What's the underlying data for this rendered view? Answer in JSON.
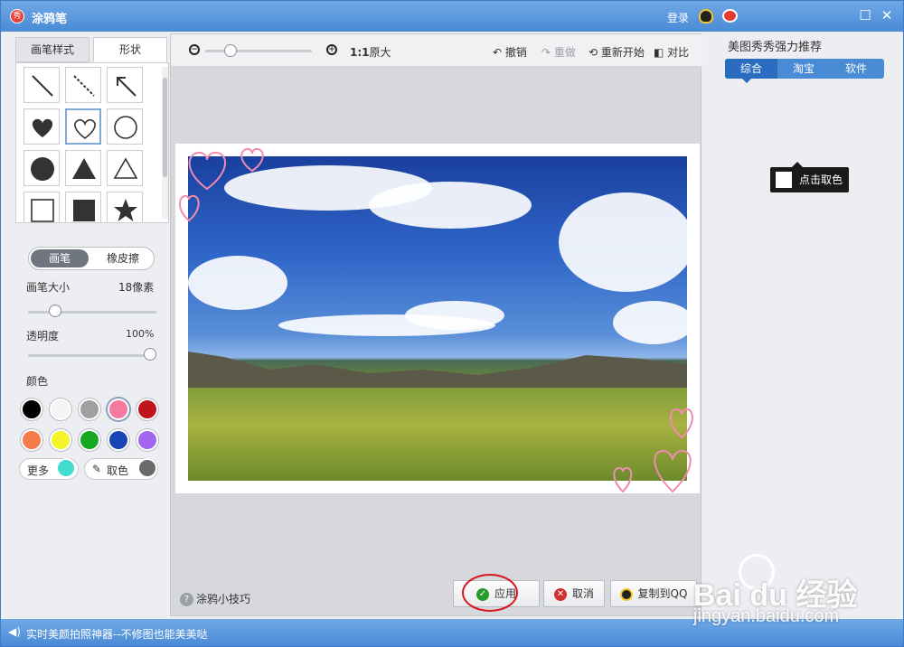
{
  "window": {
    "title": "涂鸦笔",
    "login": "登录",
    "min": "☐",
    "close": "✕"
  },
  "left": {
    "tabs": [
      {
        "label": "画笔样式"
      },
      {
        "label": "形状"
      }
    ],
    "mode": {
      "brush": "画笔",
      "eraser": "橡皮擦"
    },
    "size": {
      "label": "画笔大小",
      "value": "18像素",
      "level": 0.18
    },
    "opacity": {
      "label": "透明度",
      "value": "100%",
      "level": 1.0
    },
    "colors_label": "颜色",
    "colors": [
      "#000000",
      "#f4f4f4",
      "#a0a0a0",
      "#f47aa0",
      "#c0141c",
      "#f57a4a",
      "#f4f42a",
      "#16a822",
      "#1844b4",
      "#a266f0"
    ],
    "more_label": "更多",
    "more_color": "#44dcd0",
    "picker_label": "取色",
    "picker_color": "#6a6a6a"
  },
  "canvas": {
    "zoom_ratio": "1:1",
    "zoom_original": "原大",
    "zoom_level": 0.2,
    "undo": "撤销",
    "redo": "重做",
    "restart": "重新开始",
    "compare": "对比",
    "tips": "涂鸦小技巧",
    "apply": "应用",
    "cancel": "取消",
    "copy_qq": "复制到QQ"
  },
  "right": {
    "title": "美图秀秀强力推荐",
    "tabs": [
      {
        "label": "综合"
      },
      {
        "label": "淘宝"
      },
      {
        "label": "软件"
      }
    ],
    "pick_tip": "点击取色"
  },
  "status": {
    "text": "实时美颜拍照神器--不修图也能美美哒"
  },
  "watermark": {
    "brand": "Bai du 经验",
    "url": "jingyan.baidu.com"
  }
}
